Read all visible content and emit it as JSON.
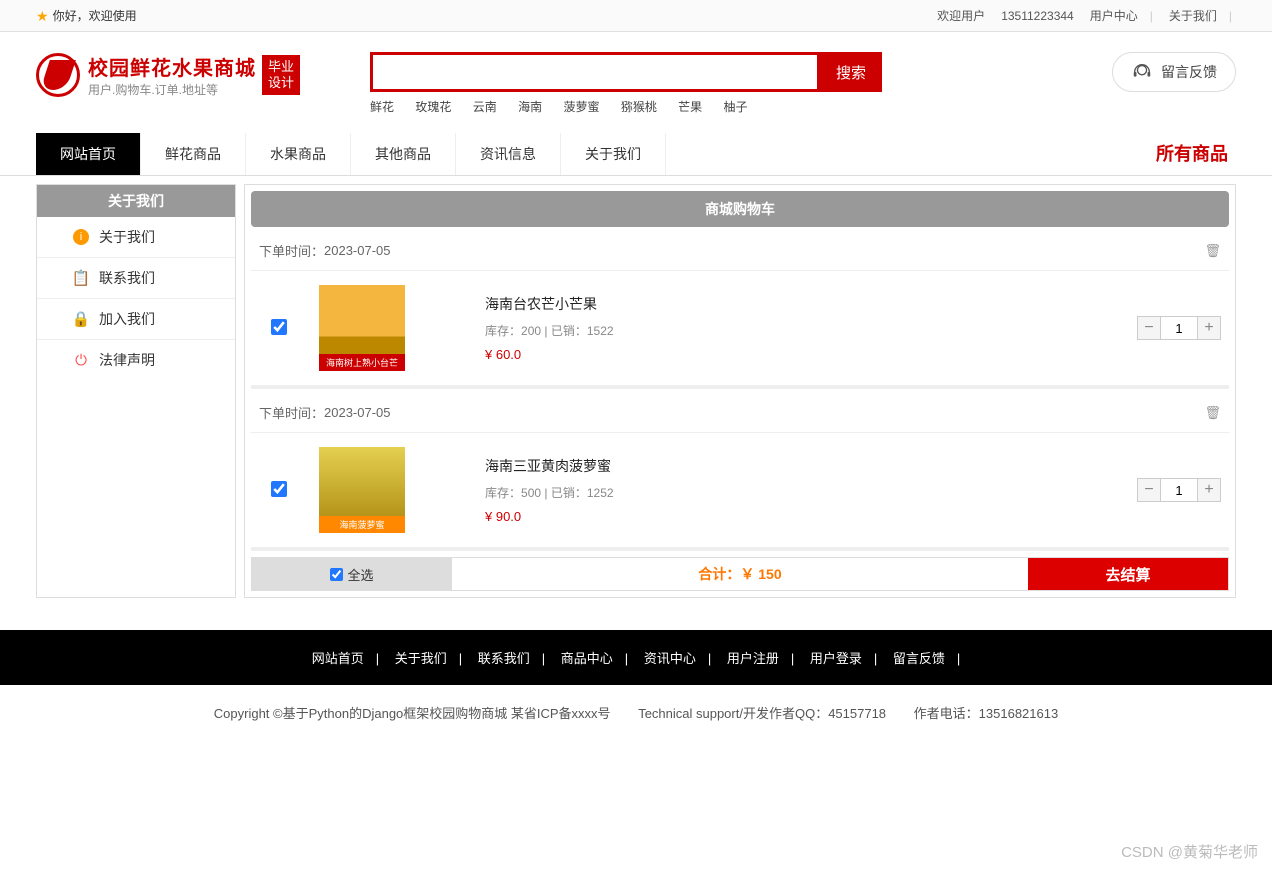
{
  "topbar": {
    "welcome": "你好，欢迎使用",
    "user_label": "欢迎用户",
    "phone": "13511223344",
    "center": "用户中心",
    "about": "关于我们"
  },
  "logo": {
    "title": "校园鲜花水果商城",
    "subtitle": "用户.购物车.订单.地址等",
    "badge1": "毕业",
    "badge2": "设计"
  },
  "search": {
    "value": "",
    "button": "搜索",
    "tags": [
      "鲜花",
      "玫瑰花",
      "云南",
      "海南",
      "菠萝蜜",
      "猕猴桃",
      "芒果",
      "柚子"
    ]
  },
  "feedback": "留言反馈",
  "nav": {
    "items": [
      "网站首页",
      "鲜花商品",
      "水果商品",
      "其他商品",
      "资讯信息",
      "关于我们"
    ],
    "all": "所有商品"
  },
  "sidebar": {
    "title": "关于我们",
    "items": [
      "关于我们",
      "联系我们",
      "加入我们",
      "法律声明"
    ]
  },
  "cart": {
    "title": "商城购物车",
    "items": [
      {
        "time_label": "下单时间：",
        "time": "2023-07-05",
        "name": "海南台农芒小芒果",
        "stock_label": "库存：",
        "stock": "200",
        "sold_label": "已销：",
        "sold": "1522",
        "price": "¥ 60.0",
        "qty": "1",
        "img_tag": "海南树上熟小台芒"
      },
      {
        "time_label": "下单时间：",
        "time": "2023-07-05",
        "name": "海南三亚黄肉菠萝蜜",
        "stock_label": "库存：",
        "stock": "500",
        "sold_label": "已销：",
        "sold": "1252",
        "price": "¥ 90.0",
        "qty": "1",
        "img_tag": "海南菠萝蜜"
      }
    ],
    "select_all": "全选",
    "total_label": "合计：",
    "total": "￥ 150",
    "checkout": "去结算"
  },
  "footer": {
    "links": [
      "网站首页",
      "关于我们",
      "联系我们",
      "商品中心",
      "资讯中心",
      "用户注册",
      "用户登录",
      "留言反馈"
    ],
    "copyright": "Copyright ©基于Python的Django框架校园购物商城 某省ICP备xxxx号",
    "support": "Technical support/开发作者QQ：45157718",
    "author_tel": "作者电话：13516821613"
  },
  "watermark": "CSDN @黄菊华老师"
}
